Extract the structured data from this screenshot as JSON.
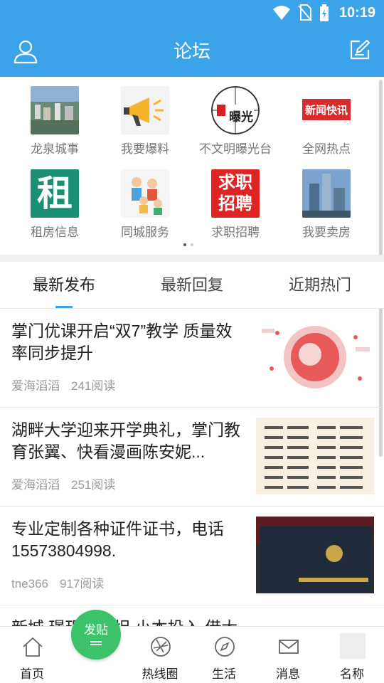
{
  "status_bar": {
    "time": "10:19"
  },
  "header": {
    "title": "论坛"
  },
  "grid": {
    "items": [
      {
        "label": "龙泉城事",
        "icon": "city-photo"
      },
      {
        "label": "我要爆料",
        "icon": "megaphone-icon"
      },
      {
        "label": "不文明曝光台",
        "icon": "exposure-logo",
        "logo_text": "曝光"
      },
      {
        "label": "全网热点",
        "icon": "news-logo",
        "logo_text": "新闻快讯"
      },
      {
        "label": "租房信息",
        "icon": "rent-logo",
        "logo_text": "租"
      },
      {
        "label": "同城服务",
        "icon": "people-illustration"
      },
      {
        "label": "求职招聘",
        "icon": "job-logo",
        "logo_text": "求职招聘"
      },
      {
        "label": "我要卖房",
        "icon": "building-photo"
      }
    ]
  },
  "tabs": [
    {
      "label": "最新发布",
      "active": true
    },
    {
      "label": "最新回复",
      "active": false
    },
    {
      "label": "近期热门",
      "active": false
    }
  ],
  "posts": [
    {
      "title": "掌门优课开启“双7”教学 质量效率同步提升",
      "author": "爱海滔滔",
      "reads": "241阅读",
      "thumb": "diagram-image"
    },
    {
      "title": "湖畔大学迎来开学典礼，掌门教育张翼、快看漫画陈安妮...",
      "author": "爱海滔滔",
      "reads": "251阅读",
      "thumb": "name-list-image"
    },
    {
      "title": "专业定制各种证件证书，电话15573804998.",
      "author": "tne366",
      "reads": "917阅读",
      "thumb": "certificate-image"
    },
    {
      "title": "新城 璟玥、王坦 小本投入 借大社区采青",
      "author": "",
      "reads": "",
      "thumb": ""
    }
  ],
  "bottom_nav": [
    {
      "label": "首页",
      "icon": "home-icon"
    },
    {
      "label": "发贴",
      "icon": "post-fab"
    },
    {
      "label": "热线圈",
      "icon": "aperture-icon"
    },
    {
      "label": "生活",
      "icon": "compass-icon"
    },
    {
      "label": "消息",
      "icon": "mail-icon"
    },
    {
      "label": "名称",
      "icon": "avatar"
    }
  ],
  "colors": {
    "primary": "#3aa3ea",
    "fab": "#3cc36a",
    "tab_underline": "#3aa3ea"
  }
}
